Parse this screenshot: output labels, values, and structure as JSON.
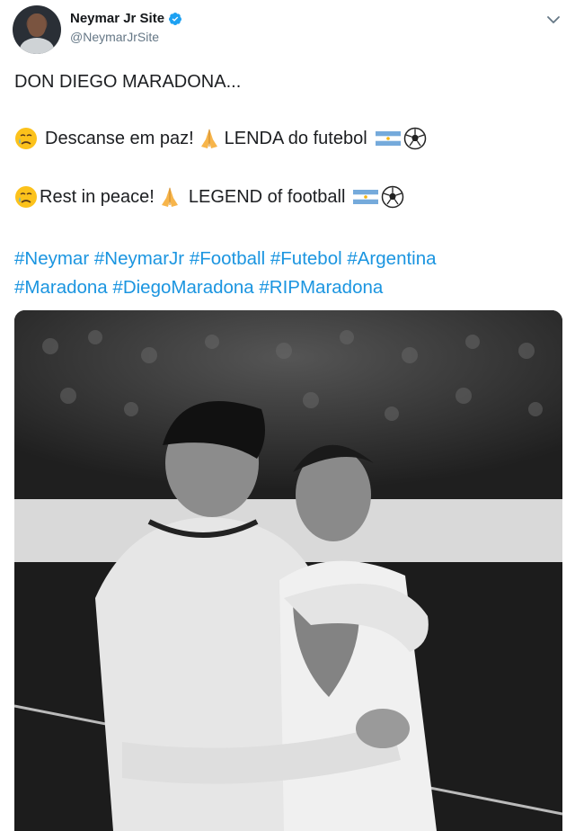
{
  "account": {
    "display_name": "Neymar Jr Site",
    "handle": "@NeymarJrSite"
  },
  "tweet": {
    "line1": "DON DIEGO MARADONA...",
    "line2_a": "Descanse em paz!",
    "line2_b": "LENDA do futebol",
    "line3_a": "Rest in peace!",
    "line3_b": "LEGEND of football",
    "hashtags_row1": [
      "#Neymar",
      "#NeymarJr",
      "#Football",
      "#Futebol",
      "#Argentina"
    ],
    "hashtags_row2": [
      "#Maradona",
      "#DiegoMaradona",
      "#RIPMaradona"
    ]
  },
  "icons": {
    "verified": "verified-badge-icon",
    "menu": "chevron-down-icon",
    "crying": "crying-face-emoji",
    "praying": "folded-hands-emoji",
    "flag": "argentina-flag-emoji",
    "ball": "soccer-ball-emoji"
  },
  "colors": {
    "link": "#1b95e0",
    "verified": "#1da1f2",
    "secondary_text": "#657786"
  }
}
